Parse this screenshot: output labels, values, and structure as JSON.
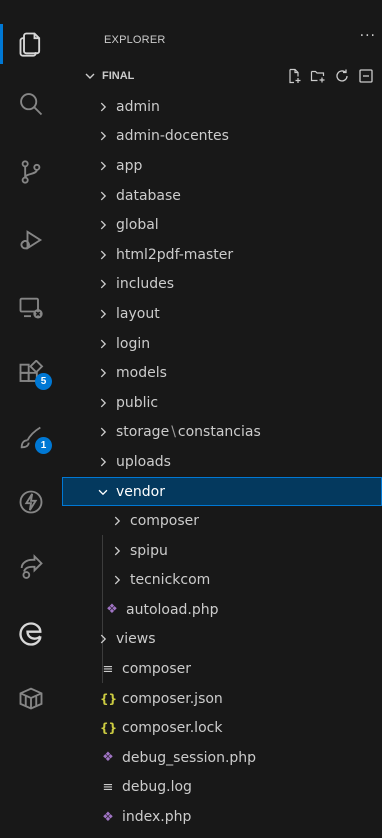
{
  "explorer": {
    "title": "EXPLORER",
    "more": "···"
  },
  "folder": {
    "name": "FINAL"
  },
  "activity_bar": {
    "badges": {
      "extensions": "5",
      "accounts": "1"
    }
  },
  "tree": [
    {
      "label": "admin",
      "type": "folder"
    },
    {
      "label": "admin-docentes",
      "type": "folder"
    },
    {
      "label": "app",
      "type": "folder"
    },
    {
      "label": "database",
      "type": "folder"
    },
    {
      "label": "global",
      "type": "folder"
    },
    {
      "label": "html2pdf-master",
      "type": "folder"
    },
    {
      "label": "includes",
      "type": "folder"
    },
    {
      "label": "layout",
      "type": "folder"
    },
    {
      "label": "login",
      "type": "folder"
    },
    {
      "label": "models",
      "type": "folder"
    },
    {
      "label": "public",
      "type": "folder"
    },
    {
      "label_a": "storage",
      "label_b": "constancias",
      "type": "folder"
    },
    {
      "label": "uploads",
      "type": "folder"
    },
    {
      "label": "vendor",
      "type": "folder-open"
    },
    {
      "label": "composer",
      "type": "subfolder"
    },
    {
      "label": "spipu",
      "type": "subfolder"
    },
    {
      "label": "tecnickcom",
      "type": "subfolder"
    },
    {
      "label": "autoload.php",
      "type": "php"
    },
    {
      "label": "views",
      "type": "folder"
    },
    {
      "label": "composer",
      "type": "text"
    },
    {
      "label": "composer.json",
      "type": "json"
    },
    {
      "label": "composer.lock",
      "type": "json"
    },
    {
      "label": "debug_session.php",
      "type": "php"
    },
    {
      "label": "debug.log",
      "type": "text"
    },
    {
      "label": "index.php",
      "type": "php"
    }
  ],
  "colors": {
    "accent": "#0078d4",
    "selected": "#04395e",
    "php": "#a074c4",
    "json": "#cbcb41"
  }
}
